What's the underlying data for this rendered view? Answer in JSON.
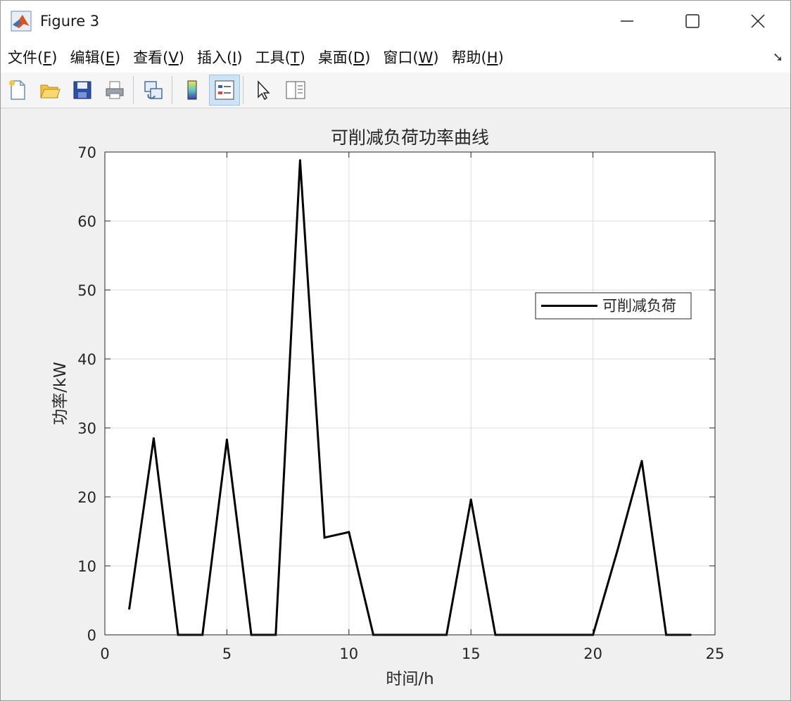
{
  "window": {
    "title": "Figure 3"
  },
  "menu": [
    {
      "label": "文件(",
      "key": "F",
      "tail": ")"
    },
    {
      "label": "编辑(",
      "key": "E",
      "tail": ")"
    },
    {
      "label": "查看(",
      "key": "V",
      "tail": ")"
    },
    {
      "label": "插入(",
      "key": "I",
      "tail": ")"
    },
    {
      "label": "工具(",
      "key": "T",
      "tail": ")"
    },
    {
      "label": "桌面(",
      "key": "D",
      "tail": ")"
    },
    {
      "label": "窗口(",
      "key": "W",
      "tail": ")"
    },
    {
      "label": "帮助(",
      "key": "H",
      "tail": ")"
    }
  ],
  "toolbar": {
    "icons": [
      "new-figure-icon",
      "open-file-icon",
      "save-icon",
      "print-icon",
      "link-plot-icon",
      "colorbar-icon",
      "legend-icon",
      "edit-plot-icon",
      "property-inspector-icon"
    ]
  },
  "chart_data": {
    "type": "line",
    "title": "可削减负荷功率曲线",
    "xlabel": "时间/h",
    "ylabel": "功率/kW",
    "xlim": [
      0,
      25
    ],
    "ylim": [
      0,
      70
    ],
    "xticks": [
      0,
      5,
      10,
      15,
      20,
      25
    ],
    "yticks": [
      0,
      10,
      20,
      30,
      40,
      50,
      60,
      70
    ],
    "grid": true,
    "legend_position": "east",
    "series": [
      {
        "name": "可削减负荷",
        "color": "#000000",
        "x": [
          1,
          2,
          3,
          4,
          5,
          6,
          7,
          8,
          9,
          10,
          11,
          12,
          13,
          14,
          15,
          16,
          17,
          18,
          19,
          20,
          21,
          22,
          23,
          24
        ],
        "y": [
          3.8,
          28.5,
          0,
          0,
          28.3,
          0,
          0,
          68.8,
          14.1,
          14.9,
          0,
          0,
          0,
          0,
          19.6,
          0,
          0,
          0,
          0,
          0,
          12.2,
          25.2,
          0,
          0
        ]
      }
    ]
  }
}
